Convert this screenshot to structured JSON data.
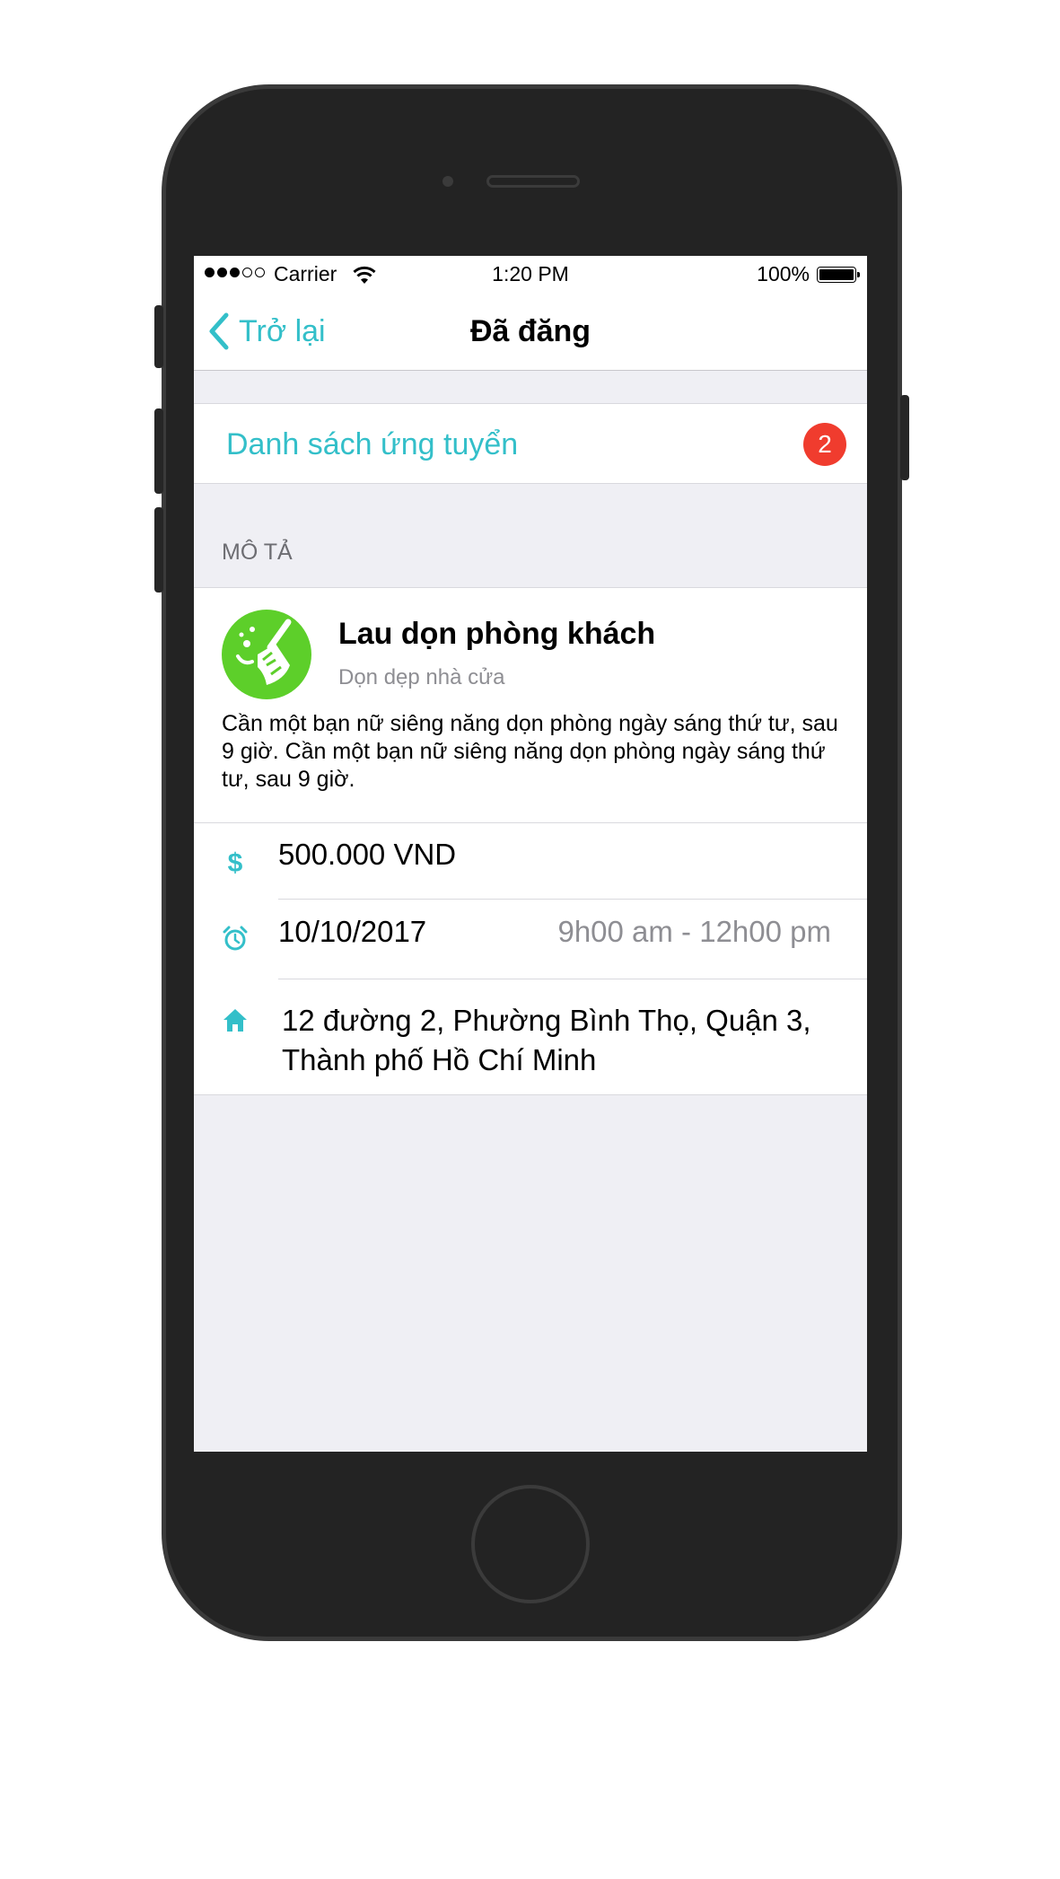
{
  "status_bar": {
    "carrier": "Carrier",
    "time": "1:20 PM",
    "battery": "100%"
  },
  "nav": {
    "back_label": "Trở lại",
    "title": "Đã đăng"
  },
  "applicants": {
    "label": "Danh sách ứng tuyển",
    "count": "2"
  },
  "section": {
    "header": "MÔ TẢ"
  },
  "task": {
    "title": "Lau dọn phòng khách",
    "category": "Dọn dẹp nhà cửa",
    "description": "Cần một bạn nữ siêng năng dọn phòng ngày sáng thứ tư, sau 9 giờ. Cần một bạn nữ siêng năng dọn phòng ngày sáng thứ tư, sau 9 giờ.",
    "price": "500.000 VND",
    "date": "10/10/2017",
    "time_range": "9h00 am - 12h00 pm",
    "address": "12 đường 2, Phường Bình Thọ, Quận 3, Thành phố Hồ Chí Minh"
  },
  "colors": {
    "accent": "#33bfc9",
    "badge": "#f03c2e",
    "task_icon": "#5dcf2a",
    "background": "#efeff4"
  },
  "icons": {
    "task": "broom-icon",
    "price": "dollar-icon",
    "date": "alarm-clock-icon",
    "address": "home-icon"
  }
}
